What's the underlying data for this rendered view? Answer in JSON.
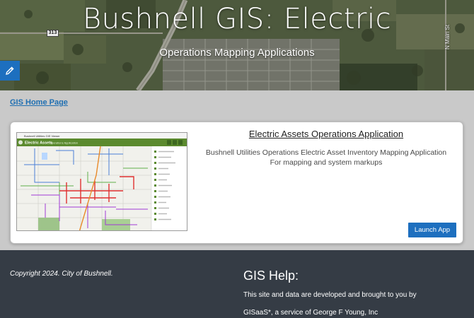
{
  "header": {
    "title": "Bushnell GIS: Electric",
    "subtitle": "Operations Mapping Applications",
    "road_shield": "313",
    "road_label": "N Main St"
  },
  "edit_button": {
    "icon": "pencil-icon"
  },
  "nav": {
    "home_link": "GIS Home Page"
  },
  "card": {
    "title": "Electric Assets Operations Application",
    "description_line1": "Bushnell Utilities Operations Electric Asset Inventory Mapping Application",
    "description_line2": "For mapping and system markups",
    "button_label": "Launch App",
    "thumbnail": {
      "app_name": "Electric Assets",
      "app_subtitle": "Operations Application",
      "top_caption": "Bushnell Utilities GIS Viewer"
    }
  },
  "footer": {
    "copyright": "Copyright 2024. City of Bushnell.",
    "help_title": "GIS Help:",
    "help_line1": "This site and data are developed and brought to you by",
    "help_line2": "GISaaS*, a service of George F Young, Inc"
  },
  "colors": {
    "accent": "#1d6fbf",
    "footer_bg": "#353c45",
    "page_bg": "#c9c9c9",
    "thumb_header": "#5b8a2e"
  }
}
